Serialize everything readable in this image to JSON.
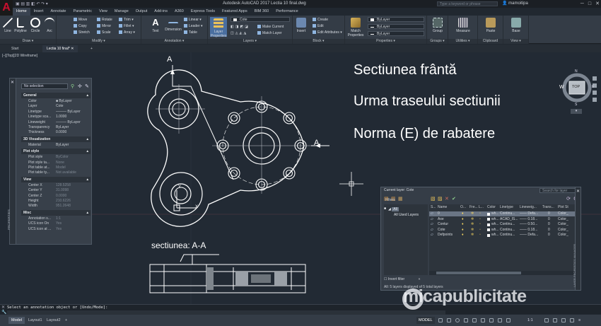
{
  "title_bar": {
    "app_title": "Autodesk AutoCAD 2017   Lectia 10 final.dwg",
    "search_placeholder": "Type a keyword or phrase",
    "user": "mamoitipa",
    "minimize": "─",
    "maximize": "□",
    "close": "✕"
  },
  "ribbon_tabs": [
    "Home",
    "Insert",
    "Annotate",
    "Parametric",
    "View",
    "Manage",
    "Output",
    "Add-ins",
    "A360",
    "Express Tools",
    "Featured Apps",
    "BIM 360",
    "Performance"
  ],
  "ribbon": {
    "draw": {
      "label": "Draw ▾",
      "tools": [
        "Line",
        "Polyline",
        "Circle",
        "Arc"
      ]
    },
    "modify": {
      "label": "Modify ▾",
      "tools": [
        "Move",
        "Rotate",
        "Trim ▾",
        "Copy",
        "Mirror",
        "Fillet ▾",
        "Stretch",
        "Scale",
        "Array ▾"
      ]
    },
    "annotation": {
      "label": "Annotation ▾",
      "tools": [
        "Text",
        "Dimension",
        "Linear ▾",
        "Leader ▾",
        "Table"
      ]
    },
    "layers": {
      "label": "Layers ▾",
      "tools": [
        "Layer Properties",
        "Make Current",
        "Match Layer"
      ],
      "current": "Cote"
    },
    "block": {
      "label": "Block ▾",
      "tools": [
        "Insert",
        "Create",
        "Edit",
        "Edit Attributes ▾"
      ]
    },
    "properties": {
      "label": "Properties ▾",
      "tools": [
        "Match Properties"
      ],
      "color": "ByLayer",
      "linetype": "ByLayer",
      "lineweight": "ByLayer"
    },
    "groups": {
      "label": "Groups ▾",
      "tools": [
        "Group"
      ]
    },
    "utilities": {
      "label": "Utilities ▾",
      "tools": [
        "Measure"
      ]
    },
    "clipboard": {
      "label": "Clipboard",
      "tools": [
        "Paste"
      ]
    },
    "view": {
      "label": "View ▾",
      "tools": [
        "Base"
      ]
    }
  },
  "file_tabs": [
    "Start",
    "Lectia 10 final*"
  ],
  "viewport": {
    "label": "[–][Top][2D Wireframe]",
    "heading1": "Sectiunea frântă",
    "heading2": "Urma traseului sectiunii",
    "heading3": "Norma (E) de rabatere",
    "section_caption": "sectiunea: A-A",
    "section_mark": "A",
    "axis_y": "Y",
    "axis_x": "X"
  },
  "nav_cube": {
    "top": "TOP",
    "n": "N",
    "s": "S",
    "w": "W",
    "e": "E"
  },
  "properties_palette": {
    "strip_label": "PROPERTIES",
    "selection": "No selection",
    "sections": [
      {
        "title": "General",
        "rows": [
          [
            "Color",
            "■ ByLayer"
          ],
          [
            "Layer",
            "Cote"
          ],
          [
            "Linetype",
            "——— ByLayer"
          ],
          [
            "Linetype sca...",
            "1.0000"
          ],
          [
            "Lineweight",
            "——— ByLayer"
          ],
          [
            "Transparency",
            "ByLayer"
          ],
          [
            "Thickness",
            "0.0000"
          ]
        ]
      },
      {
        "title": "3D Visualization",
        "rows": [
          [
            "Material",
            "ByLayer"
          ]
        ]
      },
      {
        "title": "Plot style",
        "rows": [
          [
            "Plot style",
            "ByColor"
          ],
          [
            "Plot style ta...",
            "None"
          ],
          [
            "Plot table at...",
            "Model"
          ],
          [
            "Plot table ty...",
            "Not available"
          ]
        ]
      },
      {
        "title": "View",
        "rows": [
          [
            "Center X",
            "128.5258"
          ],
          [
            "Center Y",
            "31.0098"
          ],
          [
            "Center Z",
            "0.0000"
          ],
          [
            "Height",
            "210.6226"
          ],
          [
            "Width",
            "951.2648"
          ]
        ]
      },
      {
        "title": "Misc",
        "rows": [
          [
            "Annotation s...",
            "1:1"
          ],
          [
            "UCS icon On",
            "Yes"
          ],
          [
            "UCS icon at ...",
            "Yes"
          ]
        ]
      }
    ]
  },
  "layer_manager": {
    "title": "Current layer: Cote",
    "search_placeholder": "Search for layer",
    "filters_label": "Filters",
    "tree": [
      "All",
      "All Used Layers"
    ],
    "columns": [
      "S...",
      "Name",
      "O...",
      "Fre...",
      "L...",
      "Color",
      "Linetype",
      "Lineweig...",
      "Trans...",
      "Plot St"
    ],
    "rows": [
      {
        "name": "0",
        "color": "wh...",
        "linetype": "Continu...",
        "lineweight": "—— Defa...",
        "trans": "0",
        "plot": "Color_"
      },
      {
        "name": "Axe",
        "color": "wh...",
        "linetype": "ACAD_IS...",
        "lineweight": "—— 0.18...",
        "trans": "0",
        "plot": "Color_"
      },
      {
        "name": "Contur",
        "color": "wh...",
        "linetype": "Continu...",
        "lineweight": "—— 0.50...",
        "trans": "0",
        "plot": "Color_"
      },
      {
        "name": "Cote",
        "color": "wh...",
        "linetype": "Continu...",
        "lineweight": "—— 0.18...",
        "trans": "0",
        "plot": "Color_"
      },
      {
        "name": "Defpoints",
        "color": "wh...",
        "linetype": "Continu...",
        "lineweight": "—— Defa...",
        "trans": "0",
        "plot": "Color_"
      }
    ],
    "invert_filter": "Invert filter",
    "footer": "All: 5 layers displayed of 5 total layers",
    "side_label": "LAYER PROPERTIES MANAGER"
  },
  "command_line": {
    "history": "Select an annotation object or [Undo/Mode]:",
    "prompt": "Type a command"
  },
  "status_bar": {
    "layout_tabs": [
      "Model",
      "Layout1",
      "Layout2",
      "+"
    ],
    "mode": "MODEL",
    "scale": "1:1"
  },
  "watermark": "micapublicitate"
}
